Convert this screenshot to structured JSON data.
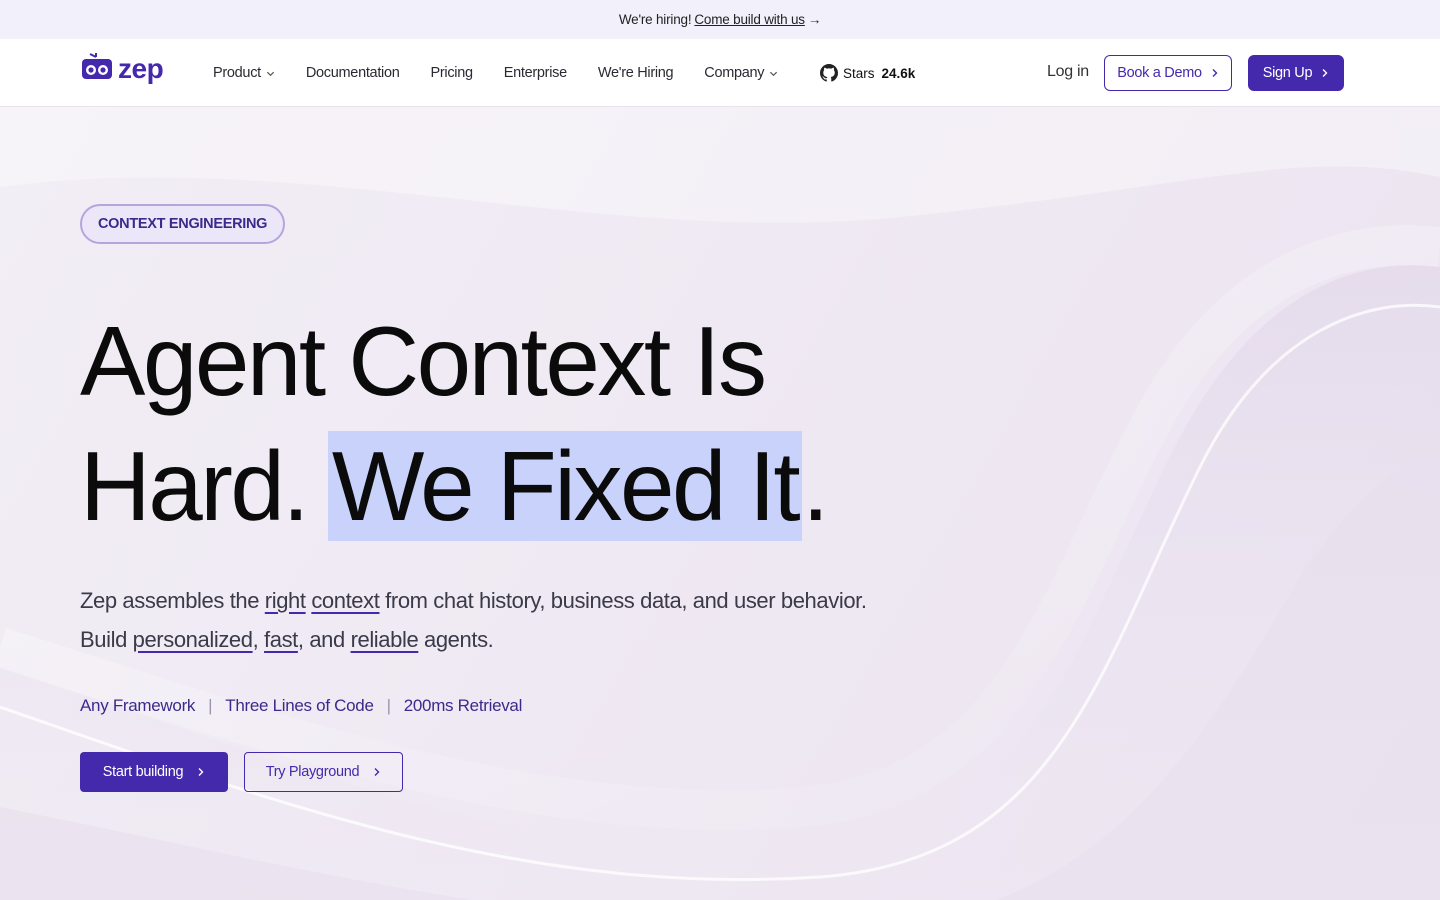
{
  "banner": {
    "text": "We're hiring!",
    "link": "Come build with us",
    "arrow": "→"
  },
  "nav": {
    "logo_text": "zep",
    "logo_icon": "robot-logo-icon",
    "items": [
      {
        "label": "Product",
        "dropdown": true
      },
      {
        "label": "Documentation",
        "dropdown": false
      },
      {
        "label": "Pricing",
        "dropdown": false
      },
      {
        "label": "Enterprise",
        "dropdown": false
      },
      {
        "label": "We're Hiring",
        "dropdown": false
      },
      {
        "label": "Company",
        "dropdown": true
      }
    ],
    "github": {
      "icon": "github-icon",
      "label": "Stars",
      "count": "24.6k"
    },
    "login": "Log in",
    "book_demo": "Book a Demo",
    "sign_up": "Sign Up"
  },
  "hero": {
    "tag": "CONTEXT ENGINEERING",
    "headline": {
      "line1": "Agent Context Is",
      "line2_plain": "Hard.",
      "line2_highlight": "We Fixed It",
      "line2_end": "."
    },
    "sub1": {
      "a": "Zep assembles the ",
      "u1": "right",
      "b": " ",
      "u2": "context",
      "c": " from chat history, business data, and user behavior."
    },
    "sub2": {
      "a": "Build ",
      "u1": "personalized",
      "b": ", ",
      "u2": "fast",
      "c": ", and ",
      "u3": "reliable",
      "d": " agents."
    },
    "features": [
      "Any Framework",
      "Three Lines of Code",
      "200ms Retrieval"
    ],
    "separator": "|",
    "cta_primary": "Start building",
    "cta_secondary": "Try Playground"
  },
  "colors": {
    "brand": "#4529ad",
    "highlight": "#c8d2fb",
    "banner_bg": "#f1f0fb"
  }
}
